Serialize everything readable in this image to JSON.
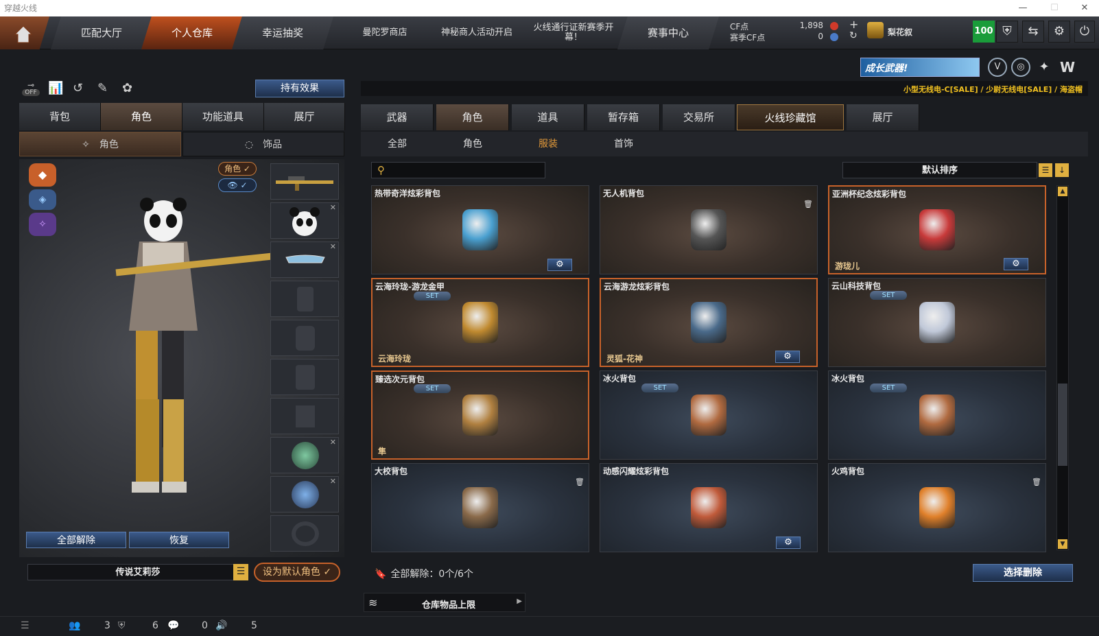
{
  "window": {
    "title": "穿越火线"
  },
  "nav": {
    "tabs": [
      "匹配大厅",
      "个人仓库",
      "幸运抽奖"
    ],
    "shop": "曼陀罗商店",
    "event1": "神秘商人活动开启",
    "event2": "火线通行证新赛季开幕！",
    "match_center": "赛事中心"
  },
  "currency": {
    "cf_label": "CF点",
    "cf_value": "1,898",
    "season_label": "赛季CF点",
    "season_value": "0"
  },
  "user": {
    "name": "梨花叙",
    "level": "100"
  },
  "banner": {
    "promo_text": "成长武器!",
    "sale_text": "小型无线电-C[SALE] / 少尉无线电[SALE] / 海盗帽"
  },
  "left": {
    "effect_button": "持有效果",
    "tabs": [
      "背包",
      "角色",
      "功能道具",
      "展厅"
    ],
    "subtabs": [
      "角色",
      "饰品"
    ],
    "badge_role": "角色 ✓",
    "btn_release_all": "全部解除",
    "btn_restore": "恢复",
    "character_name": "传说艾莉莎",
    "btn_set_default": "设为默认角色",
    "toggle_off": "OFF"
  },
  "right": {
    "tabs": [
      "武器",
      "角色",
      "道具",
      "暂存箱",
      "交易所",
      "火线珍藏馆",
      "展厅"
    ],
    "subtabs": [
      "全部",
      "角色",
      "服装",
      "首饰"
    ],
    "sort_label": "默认排序",
    "search_placeholder": "",
    "items": [
      {
        "name": "热带奇洋炫彩背包",
        "owner": "",
        "set": false,
        "gear": true,
        "trash": false,
        "style": "warm",
        "selected": false
      },
      {
        "name": "无人机背包",
        "owner": "",
        "set": false,
        "gear": false,
        "trash": true,
        "style": "warm",
        "selected": false
      },
      {
        "name": "亚洲杯纪念炫彩背包",
        "owner": "游珑儿",
        "set": false,
        "gear": true,
        "trash": false,
        "style": "warm",
        "selected": true
      },
      {
        "name": "云海玲珑-游龙金甲",
        "owner": "云海玲珑",
        "set": true,
        "gear": false,
        "trash": false,
        "style": "warm",
        "selected": true
      },
      {
        "name": "云海游龙炫彩背包",
        "owner": "灵狐-花神",
        "set": false,
        "gear": true,
        "trash": false,
        "style": "warm",
        "selected": true
      },
      {
        "name": "云山科技背包",
        "owner": "",
        "set": true,
        "gear": false,
        "trash": false,
        "style": "warm",
        "selected": false
      },
      {
        "name": "臻选次元背包",
        "owner": "隼",
        "set": true,
        "gear": false,
        "trash": false,
        "style": "warm",
        "selected": true
      },
      {
        "name": "冰火背包",
        "owner": "",
        "set": true,
        "gear": false,
        "trash": false,
        "style": "blue",
        "selected": false
      },
      {
        "name": "冰火背包",
        "owner": "",
        "set": true,
        "gear": false,
        "trash": false,
        "style": "blue",
        "selected": false
      },
      {
        "name": "大校背包",
        "owner": "",
        "set": false,
        "gear": false,
        "trash": true,
        "style": "blue",
        "selected": false
      },
      {
        "name": "动感闪耀炫彩背包",
        "owner": "",
        "set": false,
        "gear": true,
        "trash": false,
        "style": "blue",
        "selected": false
      },
      {
        "name": "火鸡背包",
        "owner": "",
        "set": false,
        "gear": false,
        "trash": true,
        "style": "blue",
        "selected": false
      }
    ],
    "set_label": "SET",
    "release_status": "全部解除：0个/6个",
    "btn_select_delete": "选择删除",
    "storage_limit": "仓库物品上限"
  },
  "status": {
    "friends": "3",
    "clan": "6",
    "chat": "0",
    "volume": "5"
  }
}
